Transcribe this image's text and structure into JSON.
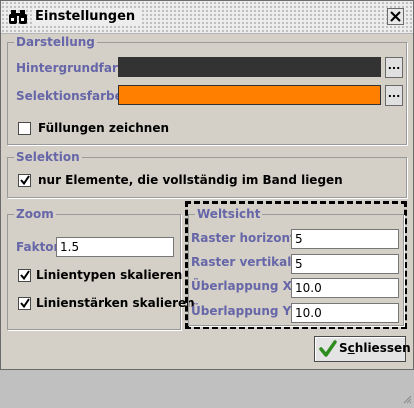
{
  "window": {
    "title": "Einstellungen",
    "icon": "binoculars-icon"
  },
  "darstellung": {
    "legend": "Darstellung",
    "background_label": "Hintergrundfarbe",
    "background_color": "#333333",
    "background_button": "...",
    "selection_label": "Selektionsfarbe",
    "selection_color": "#ff7f00",
    "selection_button": "...",
    "fill_checkbox_label": "Füllungen zeichnen",
    "fill_checked": false
  },
  "selektion": {
    "legend": "Selektion",
    "checkbox_label": "nur Elemente, die vollständig im Band liegen",
    "checked": true
  },
  "zoom": {
    "legend": "Zoom",
    "factor_label": "Faktor",
    "factor_value": "1.5",
    "line_types_label": "Linientypen skalieren",
    "line_types_checked": true,
    "line_widths_label": "Linienstärken skalieren",
    "line_widths_checked": true
  },
  "weltsicht": {
    "legend": "Weltsicht",
    "raster_h_label": "Raster horizontal",
    "raster_h_value": "5",
    "raster_v_label": "Raster vertikal",
    "raster_v_value": "5",
    "overlap_x_label": "Überlappung X",
    "overlap_x_value": "10.0",
    "overlap_y_label": "Überlappung Y",
    "overlap_y_value": "10.0"
  },
  "footer": {
    "close_label_prefix": "S",
    "close_label_mnemonic": "c",
    "close_label_rest": "hliessen",
    "close_icon": "checkmark-icon"
  },
  "colors": {
    "label_text": "#6666a8",
    "check_green": "#2e8b1e"
  }
}
